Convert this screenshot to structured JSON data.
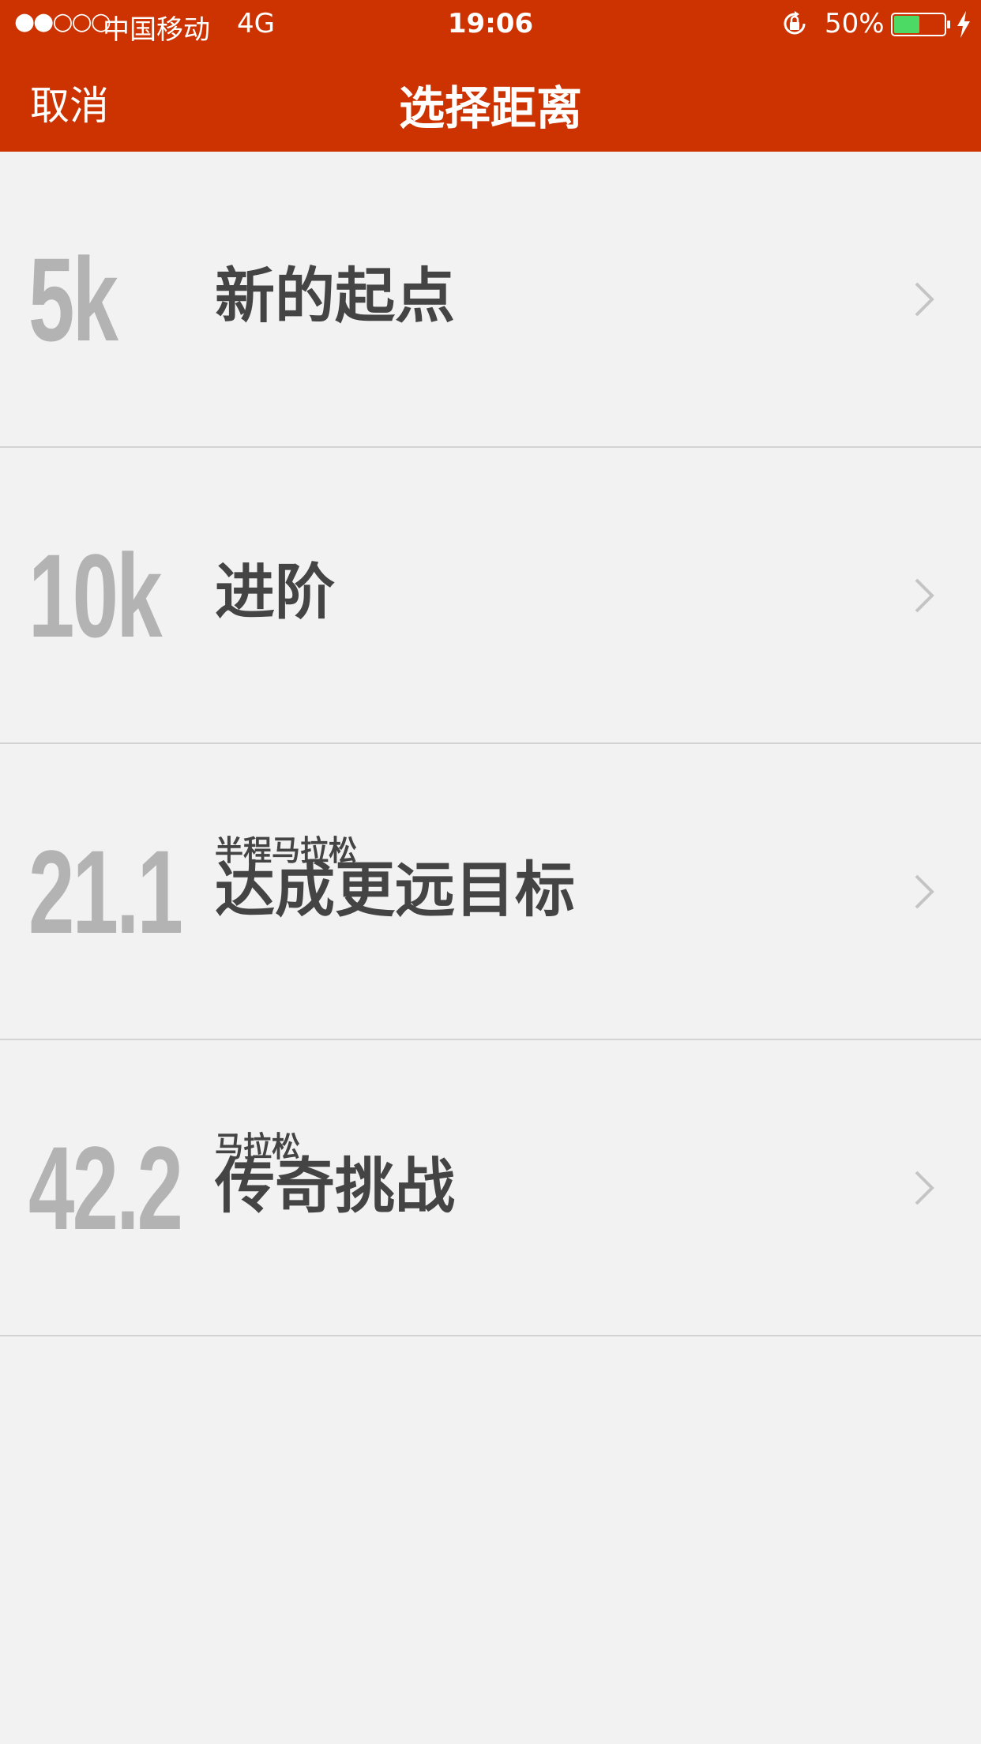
{
  "status_bar": {
    "signal": "●●○○○",
    "carrier": "中国移动",
    "network": "4G",
    "time": "19:06",
    "battery_percent": "50%",
    "icons": [
      "orientation-lock-icon",
      "battery-icon",
      "charging-bolt-icon"
    ],
    "battery_color": "#4cd964"
  },
  "nav": {
    "cancel_label": "取消",
    "title": "选择距离",
    "background_color": "#cc3300"
  },
  "distances": [
    {
      "distance": "5k",
      "subtitle": "",
      "title": "新的起点"
    },
    {
      "distance": "10k",
      "subtitle": "",
      "title": "进阶"
    },
    {
      "distance": "21.1",
      "subtitle": "半程马拉松",
      "title": "达成更远目标"
    },
    {
      "distance": "42.2",
      "subtitle": "马拉松",
      "title": "传奇挑战"
    }
  ]
}
